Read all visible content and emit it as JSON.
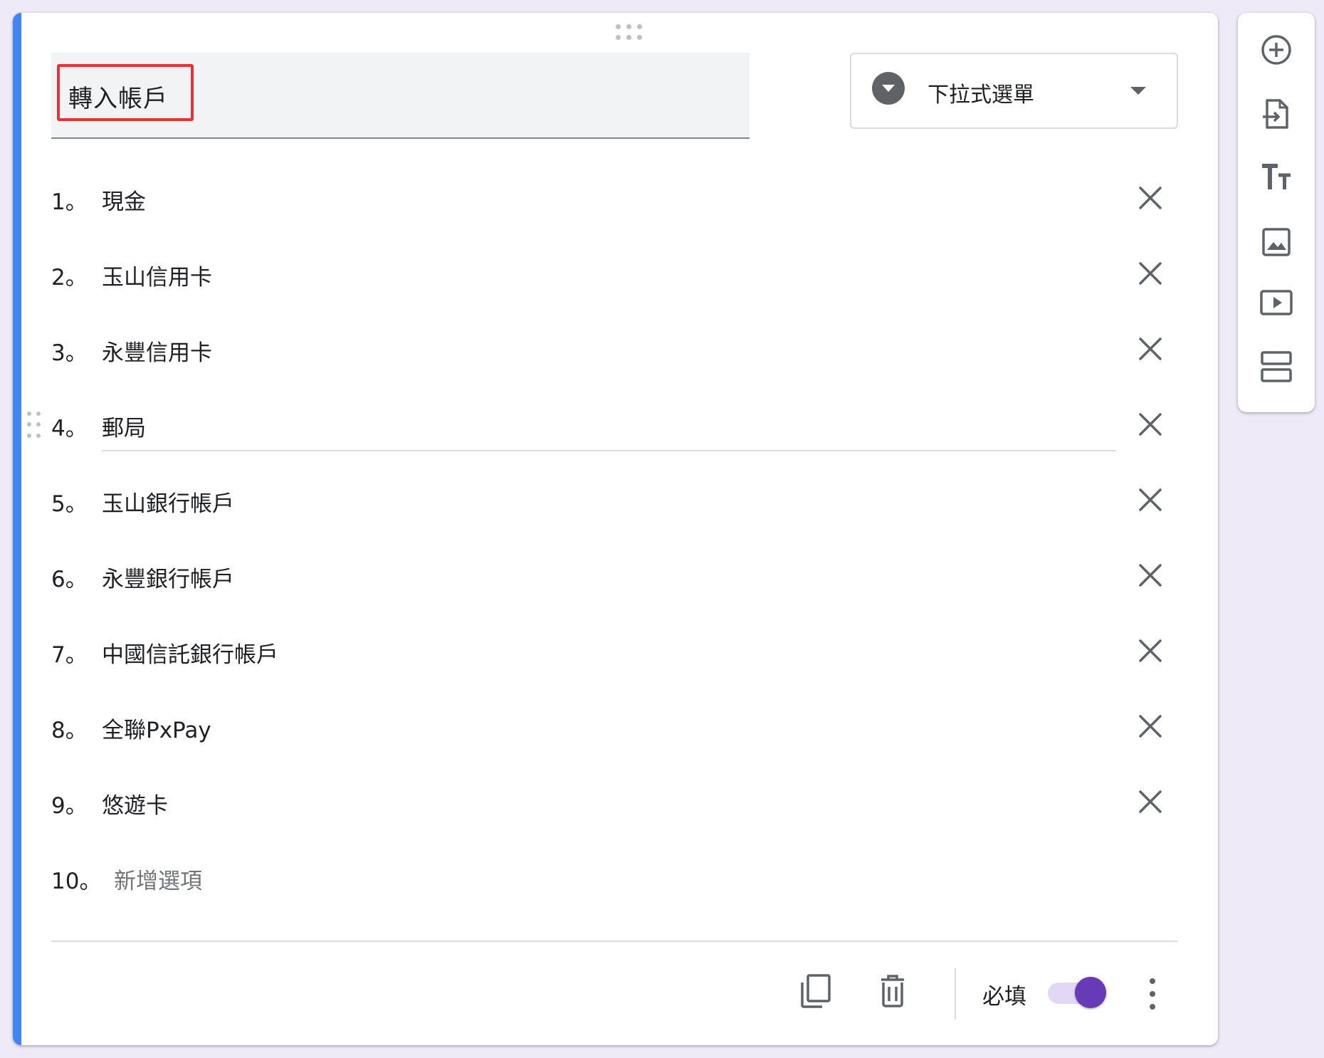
{
  "question": {
    "title": "轉入帳戶",
    "type_label": "下拉式選單"
  },
  "options": [
    {
      "number": "1。",
      "label": "現金"
    },
    {
      "number": "2。",
      "label": "玉山信用卡"
    },
    {
      "number": "3。",
      "label": "永豐信用卡"
    },
    {
      "number": "4。",
      "label": "郵局"
    },
    {
      "number": "5。",
      "label": "玉山銀行帳戶"
    },
    {
      "number": "6。",
      "label": "永豐銀行帳戶"
    },
    {
      "number": "7。",
      "label": "中國信託銀行帳戶"
    },
    {
      "number": "8。",
      "label": "全聯PxPay"
    },
    {
      "number": "9。",
      "label": "悠遊卡"
    }
  ],
  "add_option": {
    "number": "10。",
    "placeholder": "新增選項"
  },
  "footer": {
    "required_label": "必填",
    "required_on": true
  },
  "icons": {
    "question_type": "dropdown-circle-icon",
    "remove_option": "close-icon",
    "duplicate": "copy-icon",
    "delete": "trash-icon",
    "more": "more-vertical-icon",
    "toolbar": [
      "add-circle-icon",
      "import-icon",
      "title-text-icon",
      "image-icon",
      "video-icon",
      "section-icon"
    ]
  },
  "colors": {
    "accent": "#4285f4",
    "toggle_on": "#673ab7",
    "highlight_box": "#e8303b"
  }
}
